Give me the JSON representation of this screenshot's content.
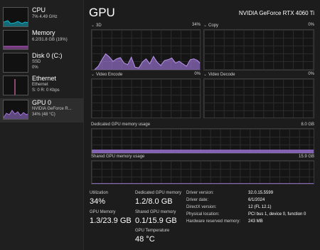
{
  "sidebar": {
    "items": [
      {
        "name": "CPU",
        "line1": "7% 4.49 GHz",
        "line2": "",
        "color": "#16b5c9"
      },
      {
        "name": "Memory",
        "line1": "6.2/31.8 GB (19%)",
        "line2": "",
        "color": "#b85cc9"
      },
      {
        "name": "Disk 0 (C:)",
        "line1": "SSD",
        "line2": "0%",
        "color": "#5db85d"
      },
      {
        "name": "Ethernet",
        "line1": "Ethernet",
        "line2": "S: 0 R: 0 Kbps",
        "color": "#c98a4c"
      },
      {
        "name": "GPU 0",
        "line1": "NVIDIA GeForce R...",
        "line2": "34% (48 °C)",
        "color": "#9f77d8"
      }
    ]
  },
  "header": {
    "title": "GPU",
    "device": "NVIDIA GeForce RTX 4060 Ti"
  },
  "graphs": {
    "g3d": {
      "label": "3D",
      "value": "34%"
    },
    "copy": {
      "label": "Copy",
      "value": "0%"
    },
    "encode": {
      "label": "Video Encode",
      "value": "0%"
    },
    "decode": {
      "label": "Video Decode",
      "value": "0%"
    },
    "dedicated": {
      "label": "Dedicated GPU memory usage",
      "value": "8.0 GB",
      "fill_fraction": 0.15
    },
    "shared": {
      "label": "Shared GPU memory usage",
      "value": "15.9 GB",
      "fill_fraction": 0.01
    }
  },
  "accent_color": "#9f77d8",
  "stats": {
    "utilization_label": "Utilization",
    "utilization_value": "34%",
    "dedicated_label": "Dedicated GPU memory",
    "dedicated_value": "1.2/8.0 GB",
    "gpu_memory_label": "GPU Memory",
    "gpu_memory_value": "1.3/23.9 GB",
    "shared_label": "Shared GPU memory",
    "shared_value": "0.1/15.9 GB",
    "temp_label": "GPU Temperature",
    "temp_value": "48 °C"
  },
  "details": [
    {
      "label": "Driver version:",
      "value": "32.0.15.5599"
    },
    {
      "label": "Driver date:",
      "value": "6/1/2024"
    },
    {
      "label": "DirectX version:",
      "value": "12 (FL 12.1)"
    },
    {
      "label": "Physical location:",
      "value": "PCI bus 1, device 0, function 0"
    },
    {
      "label": "Hardware reserved memory:",
      "value": "243 MB"
    }
  ],
  "chart_data": {
    "type": "area",
    "title": "3D",
    "ylim": [
      0,
      100
    ],
    "series": [
      {
        "name": "3D",
        "values": [
          4,
          12,
          28,
          42,
          35,
          24,
          30,
          33,
          20,
          16,
          34,
          10,
          8,
          22,
          30,
          18,
          36,
          22,
          14,
          26,
          28,
          32,
          20,
          24,
          18,
          12,
          28,
          30,
          26,
          16
        ]
      }
    ]
  }
}
